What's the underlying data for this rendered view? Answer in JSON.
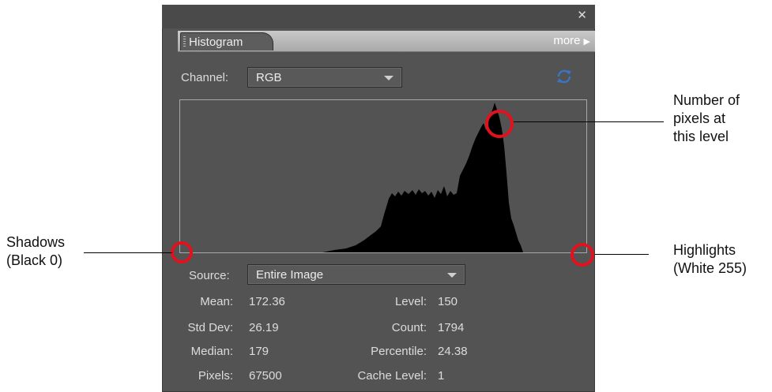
{
  "panel": {
    "close_glyph": "✕",
    "tab_label": "Histogram",
    "more_label": "more",
    "more_arrow": "▶"
  },
  "channel": {
    "label": "Channel:",
    "value": "RGB"
  },
  "source": {
    "label": "Source:",
    "value": "Entire Image"
  },
  "stats": {
    "left": [
      {
        "label": "Mean:",
        "value": "172.36"
      },
      {
        "label": "Std Dev:",
        "value": "26.19"
      },
      {
        "label": "Median:",
        "value": "179"
      },
      {
        "label": "Pixels:",
        "value": "67500"
      }
    ],
    "right": [
      {
        "label": "Level:",
        "value": "150"
      },
      {
        "label": "Count:",
        "value": "1794"
      },
      {
        "label": "Percentile:",
        "value": "24.38"
      },
      {
        "label": "Cache Level:",
        "value": "1"
      }
    ]
  },
  "annotations": {
    "pixels_line1": "Number of",
    "pixels_line2": "pixels at",
    "pixels_line3": "this level",
    "shadows_line1": "Shadows",
    "shadows_line2": "(Black 0)",
    "highlights_line1": "Highlights",
    "highlights_line2": "(White 255)"
  },
  "icons": {
    "close": "close-icon",
    "more_arrow": "triangle-right-icon",
    "refresh": "refresh-icon",
    "tab_grip": "grip-icon"
  },
  "colors": {
    "panel_bg": "#535353",
    "histogram_fill": "#000000",
    "marker": "#e1121e",
    "refresh": "#3b74c4"
  }
}
